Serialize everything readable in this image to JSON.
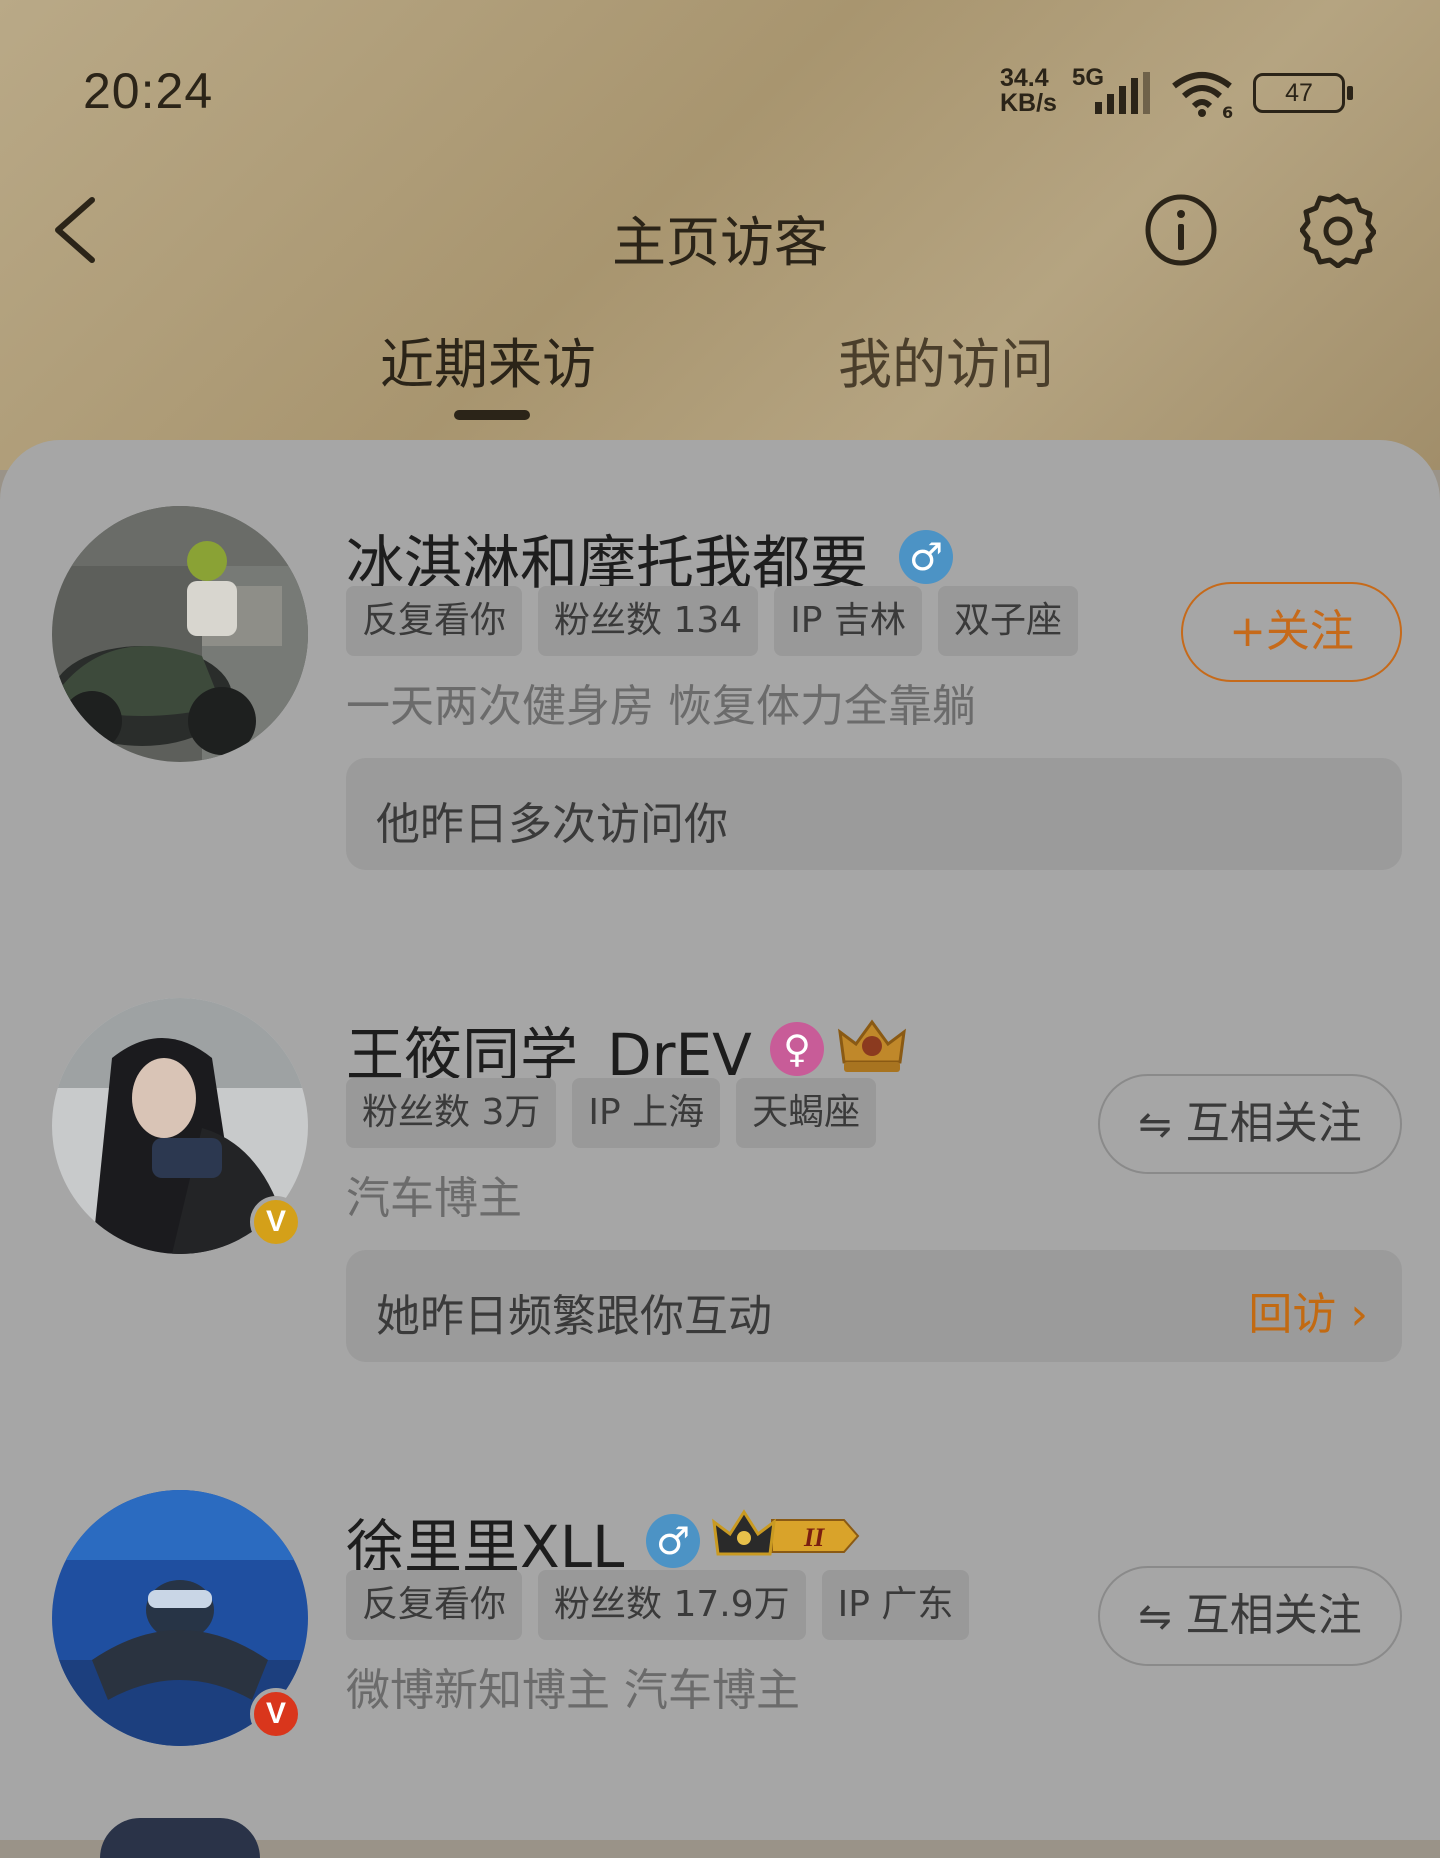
{
  "status_bar": {
    "time": "20:24",
    "net_speed_value": "34.4",
    "net_speed_unit": "KB/s",
    "network": "5G",
    "wifi_label": "6",
    "battery": "47"
  },
  "nav": {
    "title": "主页访客",
    "icons": [
      "back-icon",
      "info-icon",
      "gear-icon"
    ]
  },
  "tabs": [
    {
      "label": "近期来访",
      "active": true
    },
    {
      "label": "我的访问",
      "active": false
    }
  ],
  "visitors": [
    {
      "name": "冰淇淋和摩托我都要",
      "gender": "♂",
      "tags": [
        "反复看你",
        "粉丝数 134",
        "IP 吉林",
        "双子座"
      ],
      "bio": "一天两次健身房 恢复体力全靠躺",
      "note": "他昨日多次访问你",
      "action": "+关注"
    },
    {
      "name": "王筱同学_DrEV",
      "gender": "♀",
      "verified": "V",
      "tags": [
        "粉丝数 3万",
        "IP 上海",
        "天蝎座"
      ],
      "bio": "汽车博主",
      "note": "她昨日频繁跟你互动",
      "note_action": "回访 ›",
      "action": "互相关注",
      "action_icon": "⇋"
    },
    {
      "name": "徐里里XLL",
      "gender": "♂",
      "verified": "V",
      "tags": [
        "反复看你",
        "粉丝数 17.9万",
        "IP 广东"
      ],
      "bio": "微博新知博主 汽车博主",
      "action": "互相关注",
      "action_icon": "⇋"
    }
  ],
  "colors": {
    "accent": "#c66a1a",
    "male": "#4c93c5",
    "female": "#c85c98",
    "verified_yellow": "#d4a019",
    "verified_red": "#d9361c"
  }
}
